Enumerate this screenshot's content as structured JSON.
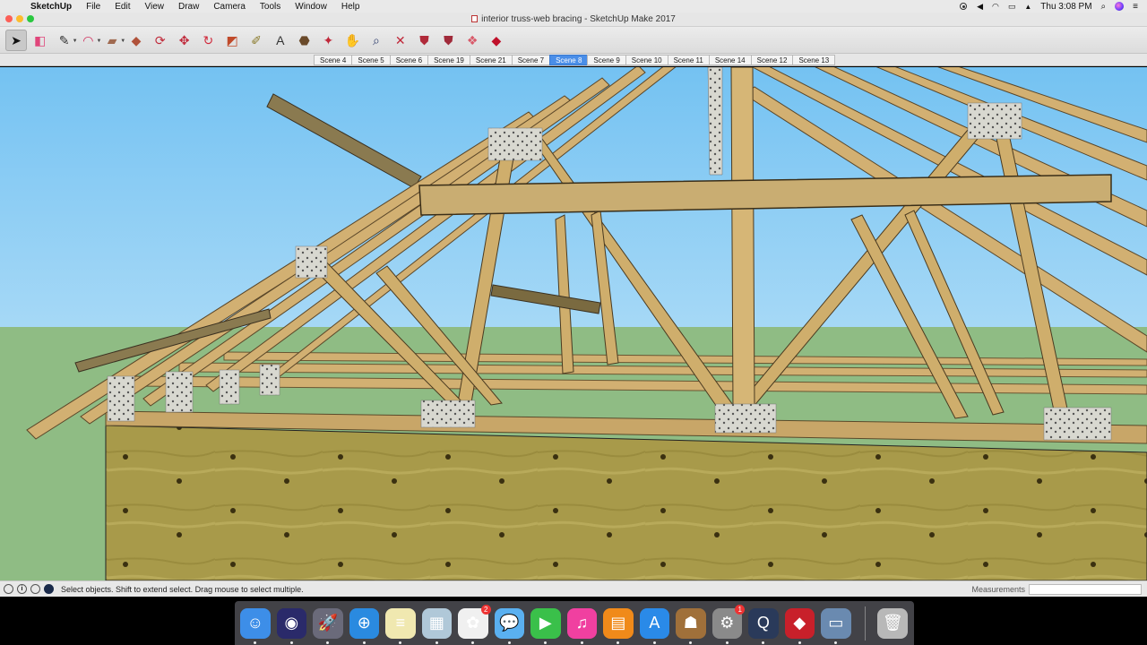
{
  "menubar": {
    "app_name": "SketchUp",
    "menus": [
      "File",
      "Edit",
      "View",
      "Draw",
      "Camera",
      "Tools",
      "Window",
      "Help"
    ],
    "clock": "Thu 3:08 PM"
  },
  "window": {
    "title": "interior truss-web bracing - SketchUp Make 2017"
  },
  "toolbar": {
    "tools": [
      {
        "name": "select-tool",
        "icon": "arrow-icon",
        "glyph": "➤",
        "color": "#111111",
        "selected": true
      },
      {
        "name": "eraser-tool",
        "icon": "eraser-icon",
        "glyph": "◧",
        "color": "#e0457a"
      },
      {
        "name": "line-tool",
        "icon": "pencil-icon",
        "glyph": "✎",
        "color": "#333333",
        "dropdown": true
      },
      {
        "name": "arc-tool",
        "icon": "arc-icon",
        "glyph": "◠",
        "color": "#d02a5a",
        "dropdown": true
      },
      {
        "name": "rectangle-tool",
        "icon": "rectangle-icon",
        "glyph": "▰",
        "color": "#a06a50",
        "dropdown": true
      },
      {
        "name": "push-pull-tool",
        "icon": "push-pull-icon",
        "glyph": "◆",
        "color": "#b0523a"
      },
      {
        "name": "offset-tool",
        "icon": "offset-icon",
        "glyph": "⟳",
        "color": "#c02a3a"
      },
      {
        "name": "move-tool",
        "icon": "move-icon",
        "glyph": "✥",
        "color": "#c0283a"
      },
      {
        "name": "rotate-tool",
        "icon": "rotate-icon",
        "glyph": "↻",
        "color": "#d0283a"
      },
      {
        "name": "scale-tool",
        "icon": "scale-icon",
        "glyph": "◩",
        "color": "#c04a2a"
      },
      {
        "name": "tape-measure-tool",
        "icon": "tape-measure-icon",
        "glyph": "✐",
        "color": "#8a7a2a"
      },
      {
        "name": "text-tool",
        "icon": "text-icon",
        "glyph": "A",
        "color": "#333333"
      },
      {
        "name": "paint-bucket-tool",
        "icon": "paint-bucket-icon",
        "glyph": "⬣",
        "color": "#6a4a2a"
      },
      {
        "name": "orbit-tool",
        "icon": "orbit-icon",
        "glyph": "✦",
        "color": "#c0283a"
      },
      {
        "name": "pan-tool",
        "icon": "hand-icon",
        "glyph": "✋",
        "color": "#d8a030"
      },
      {
        "name": "zoom-tool",
        "icon": "magnifier-icon",
        "glyph": "⌕",
        "color": "#2a3a6a"
      },
      {
        "name": "zoom-extents-tool",
        "icon": "zoom-extents-icon",
        "glyph": "✕",
        "color": "#c0283a"
      },
      {
        "name": "3d-warehouse-tool",
        "icon": "warehouse-icon",
        "glyph": "⛊",
        "color": "#b02a3a"
      },
      {
        "name": "share-model-tool",
        "icon": "share-model-icon",
        "glyph": "⛊",
        "color": "#a02a3a"
      },
      {
        "name": "extension-warehouse-tool",
        "icon": "extension-icon",
        "glyph": "❖",
        "color": "#d85a6a"
      },
      {
        "name": "ruby-console-tool",
        "icon": "ruby-icon",
        "glyph": "◆",
        "color": "#c0102a"
      }
    ]
  },
  "scenes": {
    "tabs": [
      "Scene 4",
      "Scene 5",
      "Scene 6",
      "Scene 19",
      "Scene 21",
      "Scene 7",
      "Scene 8",
      "Scene 9",
      "Scene 10",
      "Scene 11",
      "Scene 14",
      "Scene 12",
      "Scene 13"
    ],
    "active_index": 6
  },
  "status": {
    "message": "Select objects. Shift to extend select. Drag mouse to select multiple.",
    "measurements_label": "Measurements",
    "measurements_value": ""
  },
  "dock": {
    "apps": [
      {
        "name": "finder",
        "color": "#3d8ee8",
        "glyph": "☺"
      },
      {
        "name": "siri",
        "color": "#2a2a6a",
        "glyph": "◉"
      },
      {
        "name": "launchpad",
        "color": "#6a6a7a",
        "glyph": "🚀"
      },
      {
        "name": "safari",
        "color": "#2a8ae0",
        "glyph": "⊕"
      },
      {
        "name": "notes",
        "color": "#f0e8b0",
        "glyph": "≡"
      },
      {
        "name": "preview",
        "color": "#b0c8d8",
        "glyph": "▦"
      },
      {
        "name": "photos",
        "color": "#f0f0f0",
        "glyph": "✿",
        "badge": "2"
      },
      {
        "name": "messages",
        "color": "#5ab0f0",
        "glyph": "💬"
      },
      {
        "name": "facetime",
        "color": "#3ac04a",
        "glyph": "▶"
      },
      {
        "name": "itunes",
        "color": "#f040a0",
        "glyph": "♫"
      },
      {
        "name": "ibooks",
        "color": "#f08a1a",
        "glyph": "▤"
      },
      {
        "name": "app-store",
        "color": "#2a8ae8",
        "glyph": "A"
      },
      {
        "name": "contacts",
        "color": "#a0703a",
        "glyph": "☗"
      },
      {
        "name": "system-preferences",
        "color": "#8a8a8a",
        "glyph": "⚙",
        "badge": "1"
      },
      {
        "name": "quicktime",
        "color": "#2a3a5a",
        "glyph": "Q"
      },
      {
        "name": "sketchup",
        "color": "#c8202a",
        "glyph": "◆"
      },
      {
        "name": "screenshot",
        "color": "#6a8ab0",
        "glyph": "▭"
      }
    ],
    "trash": {
      "name": "trash",
      "color": "#b8b8b8",
      "glyph": "🗑"
    }
  }
}
